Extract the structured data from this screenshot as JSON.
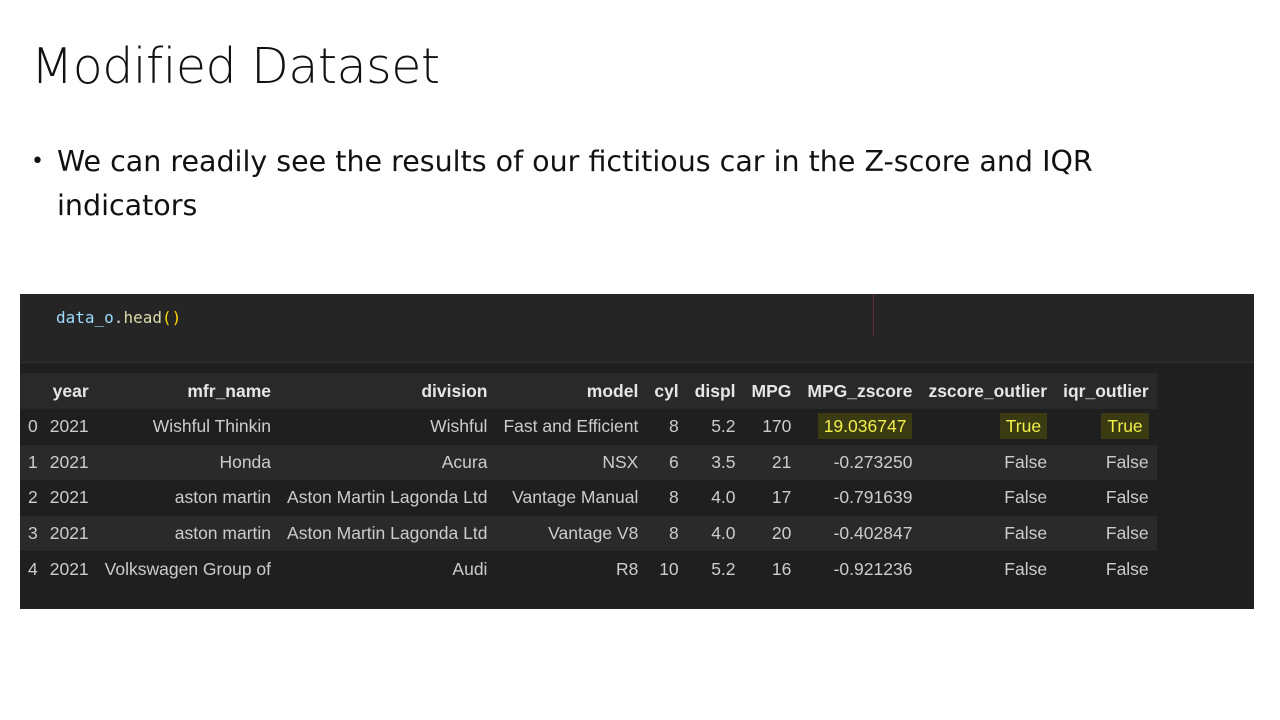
{
  "slide": {
    "title": "Modified Dataset",
    "bullet": "We can readily see the results of our fictitious car in the Z-score and IQR indicators"
  },
  "notebook": {
    "code": {
      "variable": "data_o",
      "dot": ".",
      "method": "head",
      "parens": "()"
    },
    "table": {
      "columns": [
        "",
        "year",
        "mfr_name",
        "division",
        "model",
        "cyl",
        "displ",
        "MPG",
        "MPG_zscore",
        "zscore_outlier",
        "iqr_outlier"
      ],
      "rows": [
        [
          "0",
          "2021",
          "Wishful Thinkin",
          "Wishful",
          "Fast and Efficient",
          "8",
          "5.2",
          "170",
          "19.036747",
          "True",
          "True"
        ],
        [
          "1",
          "2021",
          "Honda",
          "Acura",
          "NSX",
          "6",
          "3.5",
          "21",
          "-0.273250",
          "False",
          "False"
        ],
        [
          "2",
          "2021",
          "aston martin",
          "Aston Martin Lagonda Ltd",
          "Vantage Manual",
          "8",
          "4.0",
          "17",
          "-0.791639",
          "False",
          "False"
        ],
        [
          "3",
          "2021",
          "aston martin",
          "Aston Martin Lagonda Ltd",
          "Vantage V8",
          "8",
          "4.0",
          "20",
          "-0.402847",
          "False",
          "False"
        ],
        [
          "4",
          "2021",
          "Volkswagen Group of",
          "Audi",
          "R8",
          "10",
          "5.2",
          "16",
          "-0.921236",
          "False",
          "False"
        ]
      ],
      "highlight_color": "#f2f04a"
    }
  }
}
